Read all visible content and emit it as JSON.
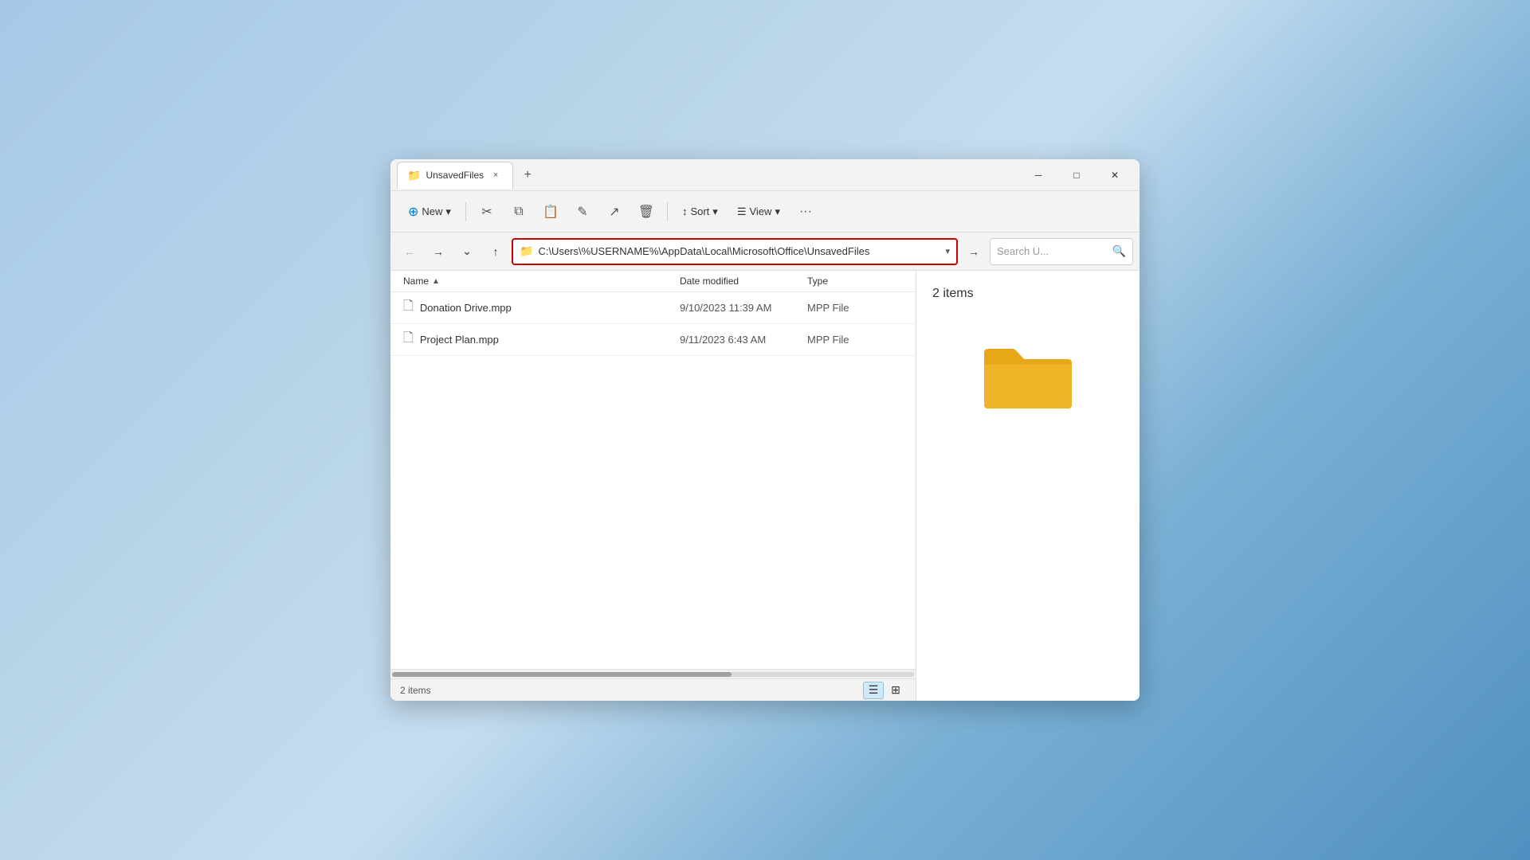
{
  "window": {
    "title": "UnsavedFiles",
    "tab_close_label": "×",
    "tab_new_label": "+",
    "minimize_label": "─",
    "maximize_label": "□",
    "close_label": "✕"
  },
  "toolbar": {
    "new_label": "New",
    "new_dropdown": "▾",
    "sort_label": "Sort",
    "sort_dropdown": "▾",
    "view_label": "View",
    "view_dropdown": "▾",
    "more_label": "···"
  },
  "addressbar": {
    "path": "C:\\Users\\%USERNAME%\\AppData\\Local\\Microsoft\\Office\\UnsavedFiles",
    "search_placeholder": "Search U...",
    "go_forward_tooltip": "Go forward"
  },
  "columns": {
    "name": "Name",
    "date_modified": "Date modified",
    "type": "Type"
  },
  "files": [
    {
      "name": "Donation Drive.mpp",
      "date_modified": "9/10/2023 11:39 AM",
      "type": "MPP File"
    },
    {
      "name": "Project Plan.mpp",
      "date_modified": "9/11/2023 6:43 AM",
      "type": "MPP File"
    }
  ],
  "preview": {
    "item_count": "2 items"
  },
  "statusbar": {
    "item_count": "2 items"
  },
  "colors": {
    "folder_yellow": "#e6a817",
    "folder_dark": "#c48a0e",
    "accent_blue": "#0078d4",
    "address_border_red": "#cc0000"
  }
}
